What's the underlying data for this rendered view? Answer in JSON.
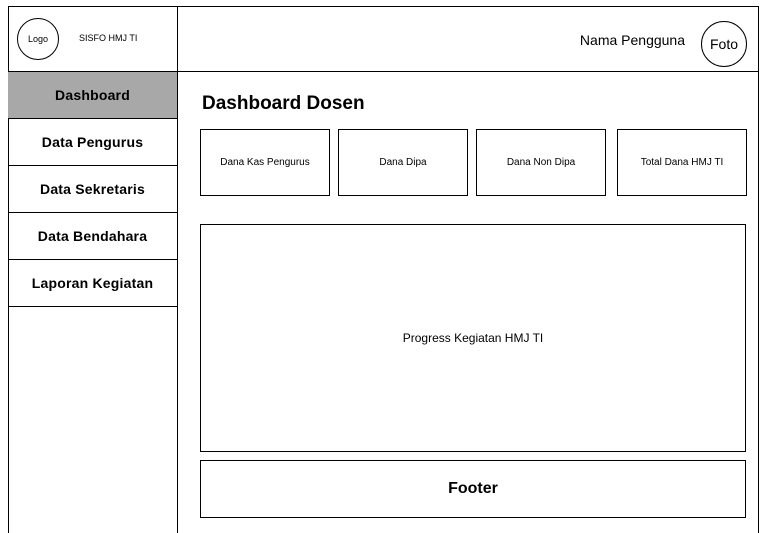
{
  "brand": {
    "logo_label": "Logo",
    "app_name": "SISFO HMJ TI"
  },
  "header": {
    "user_name": "Nama Pengguna",
    "avatar_label": "Foto"
  },
  "sidebar": {
    "items": [
      {
        "label": "Dashboard",
        "active": true
      },
      {
        "label": "Data Pengurus"
      },
      {
        "label": "Data Sekretaris"
      },
      {
        "label": "Data Bendahara"
      },
      {
        "label": "Laporan Kegiatan"
      }
    ]
  },
  "main": {
    "title": "Dashboard Dosen",
    "cards": [
      {
        "label": "Dana Kas Pengurus"
      },
      {
        "label": "Dana Dipa"
      },
      {
        "label": "Dana Non Dipa"
      },
      {
        "label": "Total Dana HMJ TI"
      }
    ],
    "panel_label": "Progress Kegiatan HMJ TI"
  },
  "footer": {
    "label": "Footer"
  }
}
